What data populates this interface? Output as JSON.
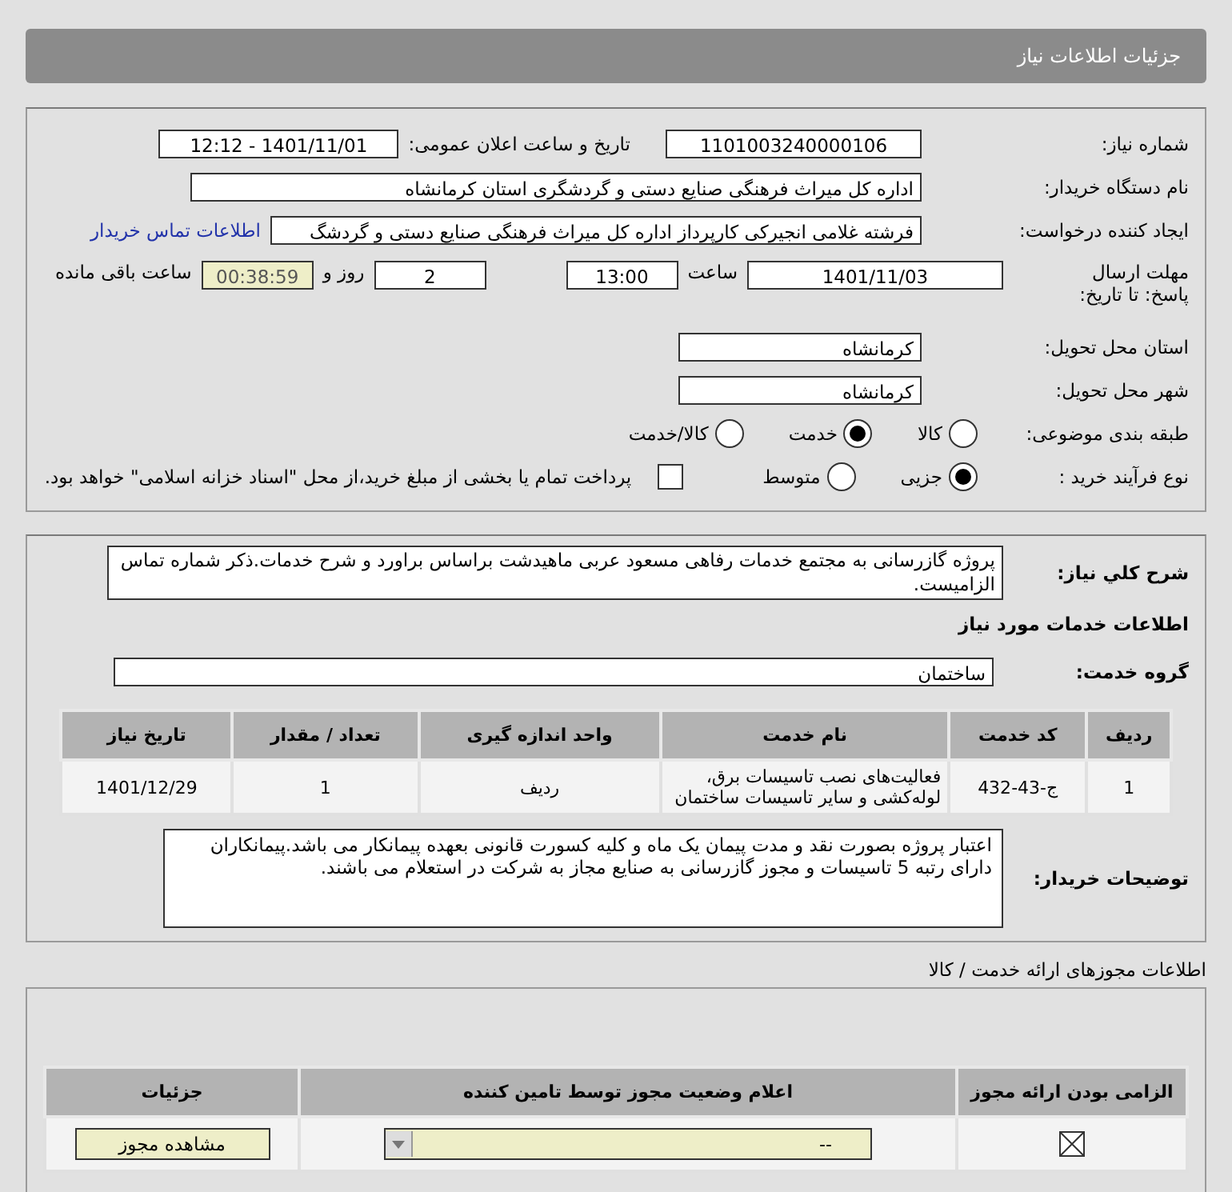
{
  "header": {
    "title": "جزئیات اطلاعات نیاز"
  },
  "need_info": {
    "need_number_label": "شماره نیاز:",
    "need_number": "1101003240000106",
    "announce_label": "تاریخ و ساعت اعلان عمومی:",
    "announce_value": "1401/11/01 - 12:12",
    "buyer_label": "نام دستگاه خریدار:",
    "buyer": "اداره کل میراث فرهنگی  صنایع دستی و گردشگری استان کرمانشاه",
    "creator_label": "ایجاد کننده درخواست:",
    "creator": "فرشته غلامی انجیرکی کارپرداز اداره کل میراث فرهنگی  صنایع دستی و گردشگ",
    "contact_link": "اطلاعات تماس خریدار",
    "deadline_label": "مهلت ارسال پاسخ: تا تاریخ:",
    "deadline_date": "1401/11/03",
    "time_label": "ساعت",
    "deadline_time": "13:00",
    "days": "2",
    "days_label": "روز و",
    "remaining": "00:38:59",
    "remaining_label": "ساعت باقی مانده",
    "province_label": "استان محل تحویل:",
    "province": "کرمانشاه",
    "city_label": "شهر محل تحویل:",
    "city": "کرمانشاه",
    "category_label": "طبقه بندی موضوعی:",
    "category_options": [
      {
        "label": "کالا",
        "selected": false
      },
      {
        "label": "خدمت",
        "selected": true
      },
      {
        "label": "کالا/خدمت",
        "selected": false
      }
    ],
    "process_label": "نوع فرآیند خرید :",
    "process_options": [
      {
        "label": "جزیی",
        "selected": true
      },
      {
        "label": "متوسط",
        "selected": false
      }
    ],
    "treasury": {
      "checked": false,
      "label": "پرداخت تمام یا بخشی از مبلغ خرید،از محل \"اسناد خزانه اسلامی\" خواهد بود."
    }
  },
  "description": {
    "label": "شرح کلي نياز:",
    "text": "پروژه گازرسانی به مجتمع خدمات رفاهی مسعود عربی ماهیدشت براساس براورد و شرح خدمات.ذکر شماره تماس الزامیست."
  },
  "services": {
    "heading": "اطلاعات خدمات مورد نیاز",
    "group_label": "گروه خدمت:",
    "group": "ساختمان",
    "table": {
      "columns": [
        "ردیف",
        "کد خدمت",
        "نام خدمت",
        "واحد اندازه گیری",
        "تعداد / مقدار",
        "تاریخ نیاز"
      ],
      "rows": [
        [
          "1",
          "ج-43-432",
          "فعالیت‌های نصب تاسیسات برق، لوله‌کشی و سایر تاسیسات ساختمان",
          "ردیف",
          "1",
          "1401/12/29"
        ]
      ]
    },
    "buyer_notes_label": "توضیحات خریدار:",
    "buyer_notes": "اعتبار پروژه بصورت نقد و مدت پیمان یک ماه و کلیه کسورت قانونی بعهده پیمانکار می باشد.پیمانکاران دارای رتبه 5 تاسیسات و مجوز گازرسانی به صنایع مجاز به شرکت در استعلام می باشند."
  },
  "licenses": {
    "title": "اطلاعات مجوزهای ارائه خدمت / کالا",
    "columns": [
      "الزامی بودن ارائه مجوز",
      "اعلام وضعیت مجوز توسط تامین کننده",
      "جزئیات"
    ],
    "rows": [
      {
        "required": true,
        "status": "--",
        "details_button": "مشاهده مجوز"
      }
    ]
  }
}
